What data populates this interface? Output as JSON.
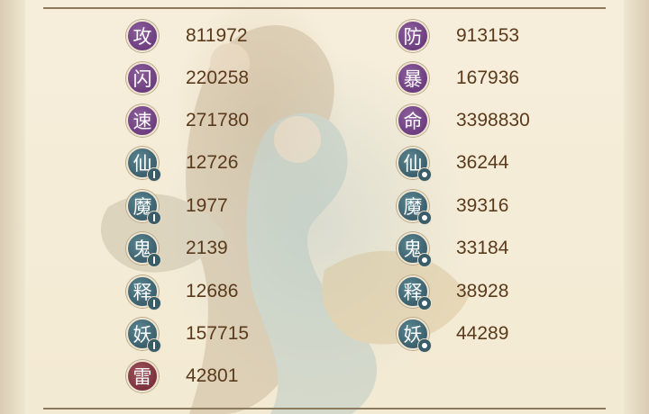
{
  "left_stats": [
    {
      "char": "攻",
      "value": "811972",
      "color": "purple",
      "mark": "none"
    },
    {
      "char": "闪",
      "value": "220258",
      "color": "purple",
      "mark": "none"
    },
    {
      "char": "速",
      "value": "271780",
      "color": "purple",
      "mark": "none"
    },
    {
      "char": "仙",
      "value": "12726",
      "color": "teal",
      "mark": "bar"
    },
    {
      "char": "魔",
      "value": "1977",
      "color": "teal",
      "mark": "bar"
    },
    {
      "char": "鬼",
      "value": "2139",
      "color": "teal",
      "mark": "bar"
    },
    {
      "char": "释",
      "value": "12686",
      "color": "teal",
      "mark": "bar"
    },
    {
      "char": "妖",
      "value": "157715",
      "color": "teal",
      "mark": "bar"
    },
    {
      "char": "雷",
      "value": "42801",
      "color": "red",
      "mark": "none"
    }
  ],
  "right_stats": [
    {
      "char": "防",
      "value": "913153",
      "color": "purple",
      "mark": "none"
    },
    {
      "char": "暴",
      "value": "167936",
      "color": "purple",
      "mark": "none"
    },
    {
      "char": "命",
      "value": "3398830",
      "color": "purple",
      "mark": "none"
    },
    {
      "char": "仙",
      "value": "36244",
      "color": "teal",
      "mark": "dot"
    },
    {
      "char": "魔",
      "value": "39316",
      "color": "teal",
      "mark": "dot"
    },
    {
      "char": "鬼",
      "value": "33184",
      "color": "teal",
      "mark": "dot"
    },
    {
      "char": "释",
      "value": "38928",
      "color": "teal",
      "mark": "dot"
    },
    {
      "char": "妖",
      "value": "44289",
      "color": "teal",
      "mark": "dot"
    }
  ],
  "colors": {
    "purple": "#6c3e7f",
    "teal": "#3b5f6c",
    "red": "#7a323c",
    "value_text": "#5b3a1c",
    "background": "#f4ecd6"
  },
  "icons": {
    "bar_mark": "resist-bar-icon",
    "dot_mark": "resist-dot-icon"
  }
}
